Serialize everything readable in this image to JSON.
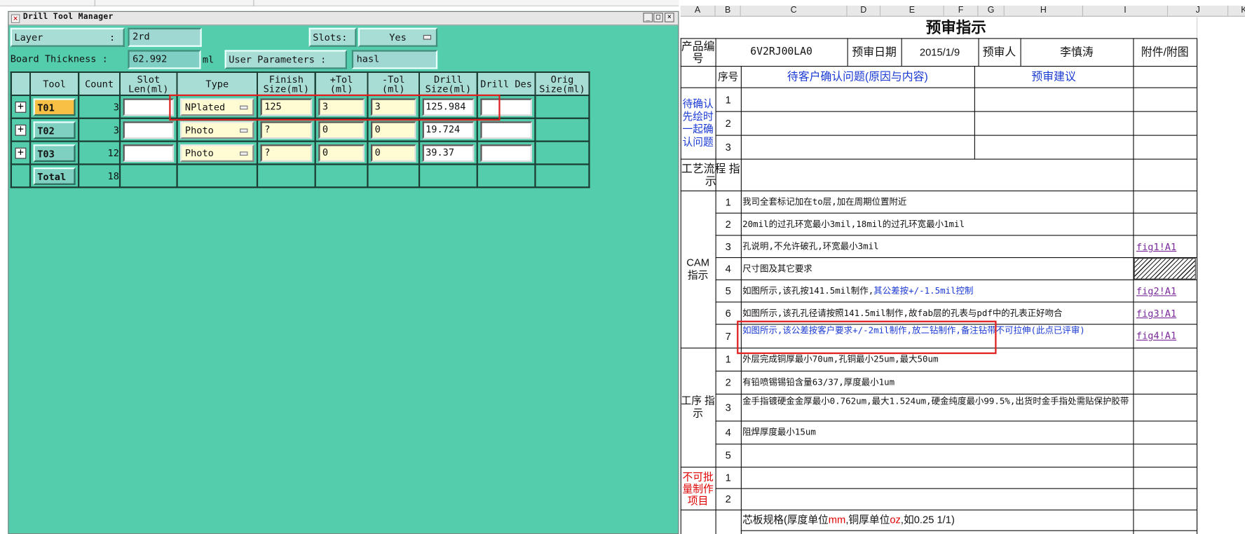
{
  "drill_tool_manager": {
    "title": "Drill Tool Manager",
    "window_buttons": [
      "_",
      "□",
      "×"
    ],
    "layer_label": "Layer",
    "layer_colon": ":",
    "layer_value": "2rd",
    "slots_label": "Slots:",
    "slots_value": "Yes",
    "board_thickness_label": "Board Thickness :",
    "board_thickness_value": "62.992",
    "board_thickness_unit": "ml",
    "user_params_label": "User Parameters :",
    "user_params_value": "hasl",
    "columns": [
      "Tool",
      "Count",
      "Slot Len(ml)",
      "Type",
      "Finish Size(ml)",
      "+Tol (ml)",
      "-Tol (ml)",
      "Drill Size(ml)",
      "Drill Des",
      "Orig Size(ml)"
    ],
    "rows": [
      {
        "tool": "T01",
        "count": "3",
        "slot_len": "",
        "type": "NPlated",
        "finish": "125",
        "ptol": "3",
        "ntol": "3",
        "drill": "125.984",
        "des": "",
        "orig": ""
      },
      {
        "tool": "T02",
        "count": "3",
        "slot_len": "",
        "type": "Photo",
        "finish": "?",
        "ptol": "0",
        "ntol": "0",
        "drill": "19.724",
        "des": "",
        "orig": ""
      },
      {
        "tool": "T03",
        "count": "12",
        "slot_len": "",
        "type": "Photo",
        "finish": "?",
        "ptol": "0",
        "ntol": "0",
        "drill": "39.37",
        "des": "",
        "orig": ""
      }
    ],
    "total_label": "Total",
    "total_count": "18"
  },
  "spreadsheet": {
    "columns": [
      "A",
      "B",
      "C",
      "D",
      "E",
      "F",
      "G",
      "H",
      "I",
      "J",
      "K"
    ],
    "title": "预审指示",
    "product_no_label": "产品编号",
    "product_no": "6V2RJ00LA0",
    "review_date_label": "预审日期",
    "review_date": "2015/1/9",
    "reviewer_label": "预审人",
    "reviewer": "李慎涛",
    "attachment_label": "附件/附图",
    "seq_label": "序号",
    "pending_label": "待客户确认问题(原因与内容)",
    "suggestion_label": "预审建议",
    "pending_side": "待确认 先绘时 一起确 认问题",
    "process_flow_label": "工艺流程 指示",
    "cam_label": "CAM 指示",
    "cam_rows": [
      {
        "n": "1",
        "text": "我司全套标记加在to层,加在周期位置附近",
        "link": ""
      },
      {
        "n": "2",
        "text": "20mil的过孔环宽最小3mil,18mil的过孔环宽最小1mil",
        "link": ""
      },
      {
        "n": "3",
        "text": "孔说明,不允许破孔,环宽最小3mil",
        "link": "fig1!A1"
      },
      {
        "n": "4",
        "text": "尺寸图及其它要求",
        "link": ""
      },
      {
        "n": "5",
        "text": "如图所示,该孔按141.5mil制作,",
        "text_blue": "其公差按+/-1.5mil控制",
        "link": "fig2!A1"
      },
      {
        "n": "6",
        "text": "如图所示,该孔孔径请按照141.5mil制作,故fab层的孔表与pdf中的孔表正好吻合",
        "link": "fig3!A1"
      },
      {
        "n": "7",
        "text": "如图所示,该公差按客户要求+/-2mil制作,放二钻制作,备注钻带不可拉伸(此点已评审)",
        "link": "fig4!A1"
      }
    ],
    "process_label": "工序 指示",
    "process_rows": [
      {
        "n": "1",
        "text": "外层完成铜厚最小70um,孔铜最小25um,最大50um"
      },
      {
        "n": "2",
        "text": "有铅喷锡锡铅含量63/37,厚度最小1um"
      },
      {
        "n": "3",
        "text": "金手指镀硬金金厚最小0.762um,最大1.524um,硬金纯度最小99.5%,出货时金手指处需贴保护胶带"
      },
      {
        "n": "4",
        "text": "阻焊厚度最小15um"
      },
      {
        "n": "5",
        "text": ""
      }
    ],
    "nobatch_label": "不可批 量制作 项目",
    "nobatch_rows": [
      "1",
      "2"
    ],
    "core_spec_text": "芯板规格(厚度单位",
    "core_spec_mm": "mm",
    "core_spec_mid": ",铜厚单位",
    "core_spec_oz": "oz",
    "core_spec_tail": ",如0.25 1/1)"
  }
}
